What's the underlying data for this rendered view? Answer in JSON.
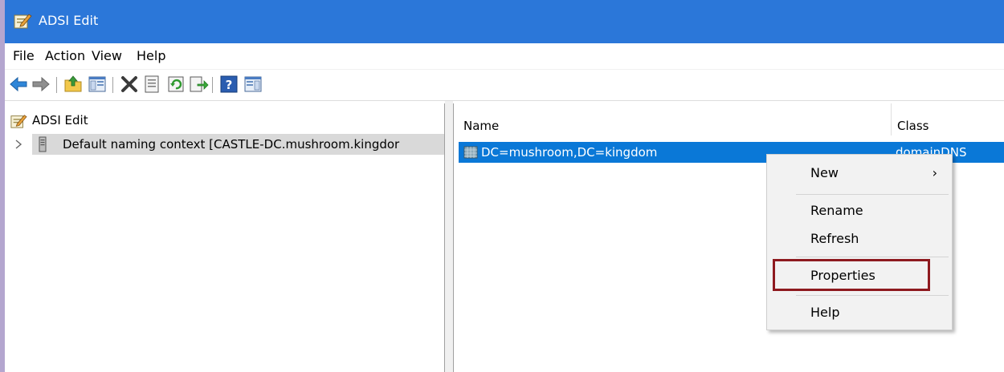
{
  "window": {
    "title": "ADSI Edit",
    "app_icon": "adsi-edit-app-icon"
  },
  "menubar": {
    "items": [
      {
        "label": "File"
      },
      {
        "label": "Action"
      },
      {
        "label": "View"
      },
      {
        "label": "Help"
      }
    ]
  },
  "toolbar": {
    "icons": [
      "back-arrow-icon",
      "forward-arrow-icon",
      "up-folder-icon",
      "show-hide-tree-icon",
      "delete-x-icon",
      "properties-sheet-icon",
      "refresh-icon",
      "export-list-icon",
      "help-icon",
      "show-hide-action-pane-icon"
    ]
  },
  "tree": {
    "root": {
      "label": "ADSI Edit"
    },
    "child": {
      "label": "Default naming context [CASTLE-DC.mushroom.kingdor"
    }
  },
  "list": {
    "columns": [
      {
        "label": "Name"
      },
      {
        "label": "Class"
      }
    ],
    "rows": [
      {
        "name": "DC=mushroom,DC=kingdom",
        "class": "domainDNS"
      }
    ]
  },
  "context_menu": {
    "items": [
      {
        "label": "New",
        "submenu": "›"
      },
      {
        "label": "Rename"
      },
      {
        "label": "Refresh"
      },
      {
        "label": "Properties",
        "highlighted": true
      },
      {
        "label": "Help"
      }
    ]
  },
  "colors": {
    "titlebar": "#2b77d9",
    "selection": "#0a78d7",
    "highlight_box": "#8e1a1f",
    "desktop": "#b4a6cf"
  }
}
